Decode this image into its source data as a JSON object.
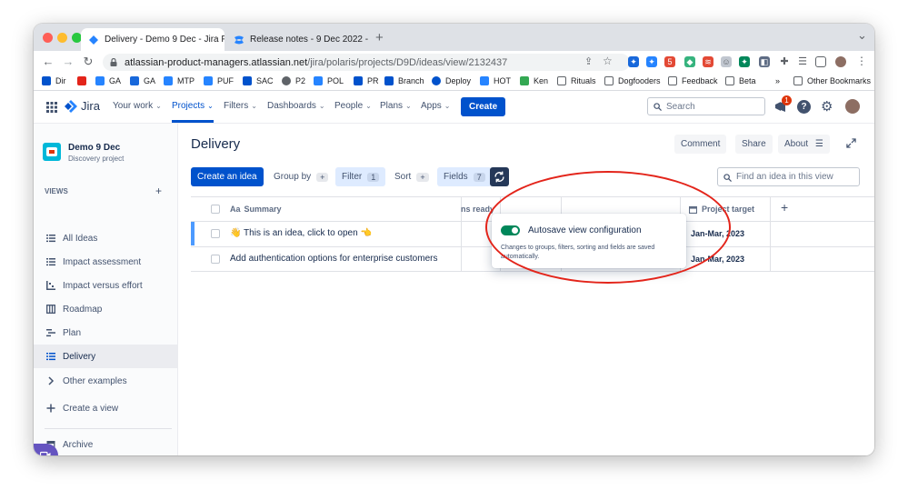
{
  "browser": {
    "tabs": [
      {
        "title": "Delivery - Demo 9 Dec - Jira P",
        "close": "✕"
      },
      {
        "title": "Release notes - 9 Dec 2022 -",
        "close": "✕"
      }
    ],
    "new_tab": "+",
    "tab_menu": "⌄",
    "url_host": "atlassian-product-managers.atlassian.net",
    "url_path": "/jira/polaris/projects/D9D/ideas/view/2132437",
    "extension_badge": "5",
    "bookmarks": [
      "Dir",
      "GA",
      "GA",
      "MTP",
      "PUF",
      "SAC",
      "P2",
      "POL",
      "PR",
      "Branch",
      "Deploy",
      "HOT",
      "Ken",
      "Rituals",
      "Dogfooders",
      "Feedback",
      "Beta"
    ],
    "bookmarks_overflow": "»",
    "other_bookmarks": "Other Bookmarks"
  },
  "jira": {
    "logo": "Jira",
    "nav": [
      "Your work",
      "Projects",
      "Filters",
      "Dashboards",
      "People",
      "Plans",
      "Apps"
    ],
    "create": "Create",
    "search_placeholder": "Search",
    "notification_count": "1"
  },
  "sidebar": {
    "project_name": "Demo 9 Dec",
    "project_type": "Discovery project",
    "views_label": "VIEWS",
    "add_view": "+",
    "items": [
      {
        "label": "All Ideas",
        "icon": "list-icon"
      },
      {
        "label": "Impact assessment",
        "icon": "list-icon"
      },
      {
        "label": "Impact versus effort",
        "icon": "matrix-icon"
      },
      {
        "label": "Roadmap",
        "icon": "board-icon"
      },
      {
        "label": "Plan",
        "icon": "timeline-icon"
      },
      {
        "label": "Delivery",
        "icon": "list-icon",
        "active": true
      },
      {
        "label": "Other examples",
        "icon": "chevron-right-icon"
      }
    ],
    "create_view": "Create a view",
    "archive": "Archive"
  },
  "main": {
    "title": "Delivery",
    "comment": "Comment",
    "share": "Share",
    "about": "About",
    "toolbar": {
      "create_idea": "Create an idea",
      "group_by": "Group by",
      "group_by_add": "+",
      "filter": "Filter",
      "filter_count": "1",
      "sort": "Sort",
      "sort_add": "+",
      "fields": "Fields",
      "fields_count": "7",
      "find_placeholder": "Find an idea in this view"
    },
    "table": {
      "col_summary_prefix": "Aa",
      "col_summary": "Summary",
      "col_ready_partial": "ns ready",
      "col_project_target": "Project target",
      "add_column": "+",
      "rows": [
        {
          "summary": "👋 This is an idea, click to open 👈",
          "project_target": "Jan-Mar, 2023",
          "rating": 0,
          "progress": 0
        },
        {
          "summary": "Add authentication options for enterprise customers",
          "project_target": "Jan-Mar, 2023",
          "rating": 5,
          "progress": 0
        }
      ]
    },
    "popup": {
      "title": "Autosave view configuration",
      "description": "Changes to groups, filters, sorting and fields are saved automatically.",
      "enabled": true
    }
  },
  "colors": {
    "jira_blue": "#0052cc",
    "annotation_red": "#e3241a",
    "toggle_green": "#00875a",
    "rating_red": "#f87168"
  }
}
